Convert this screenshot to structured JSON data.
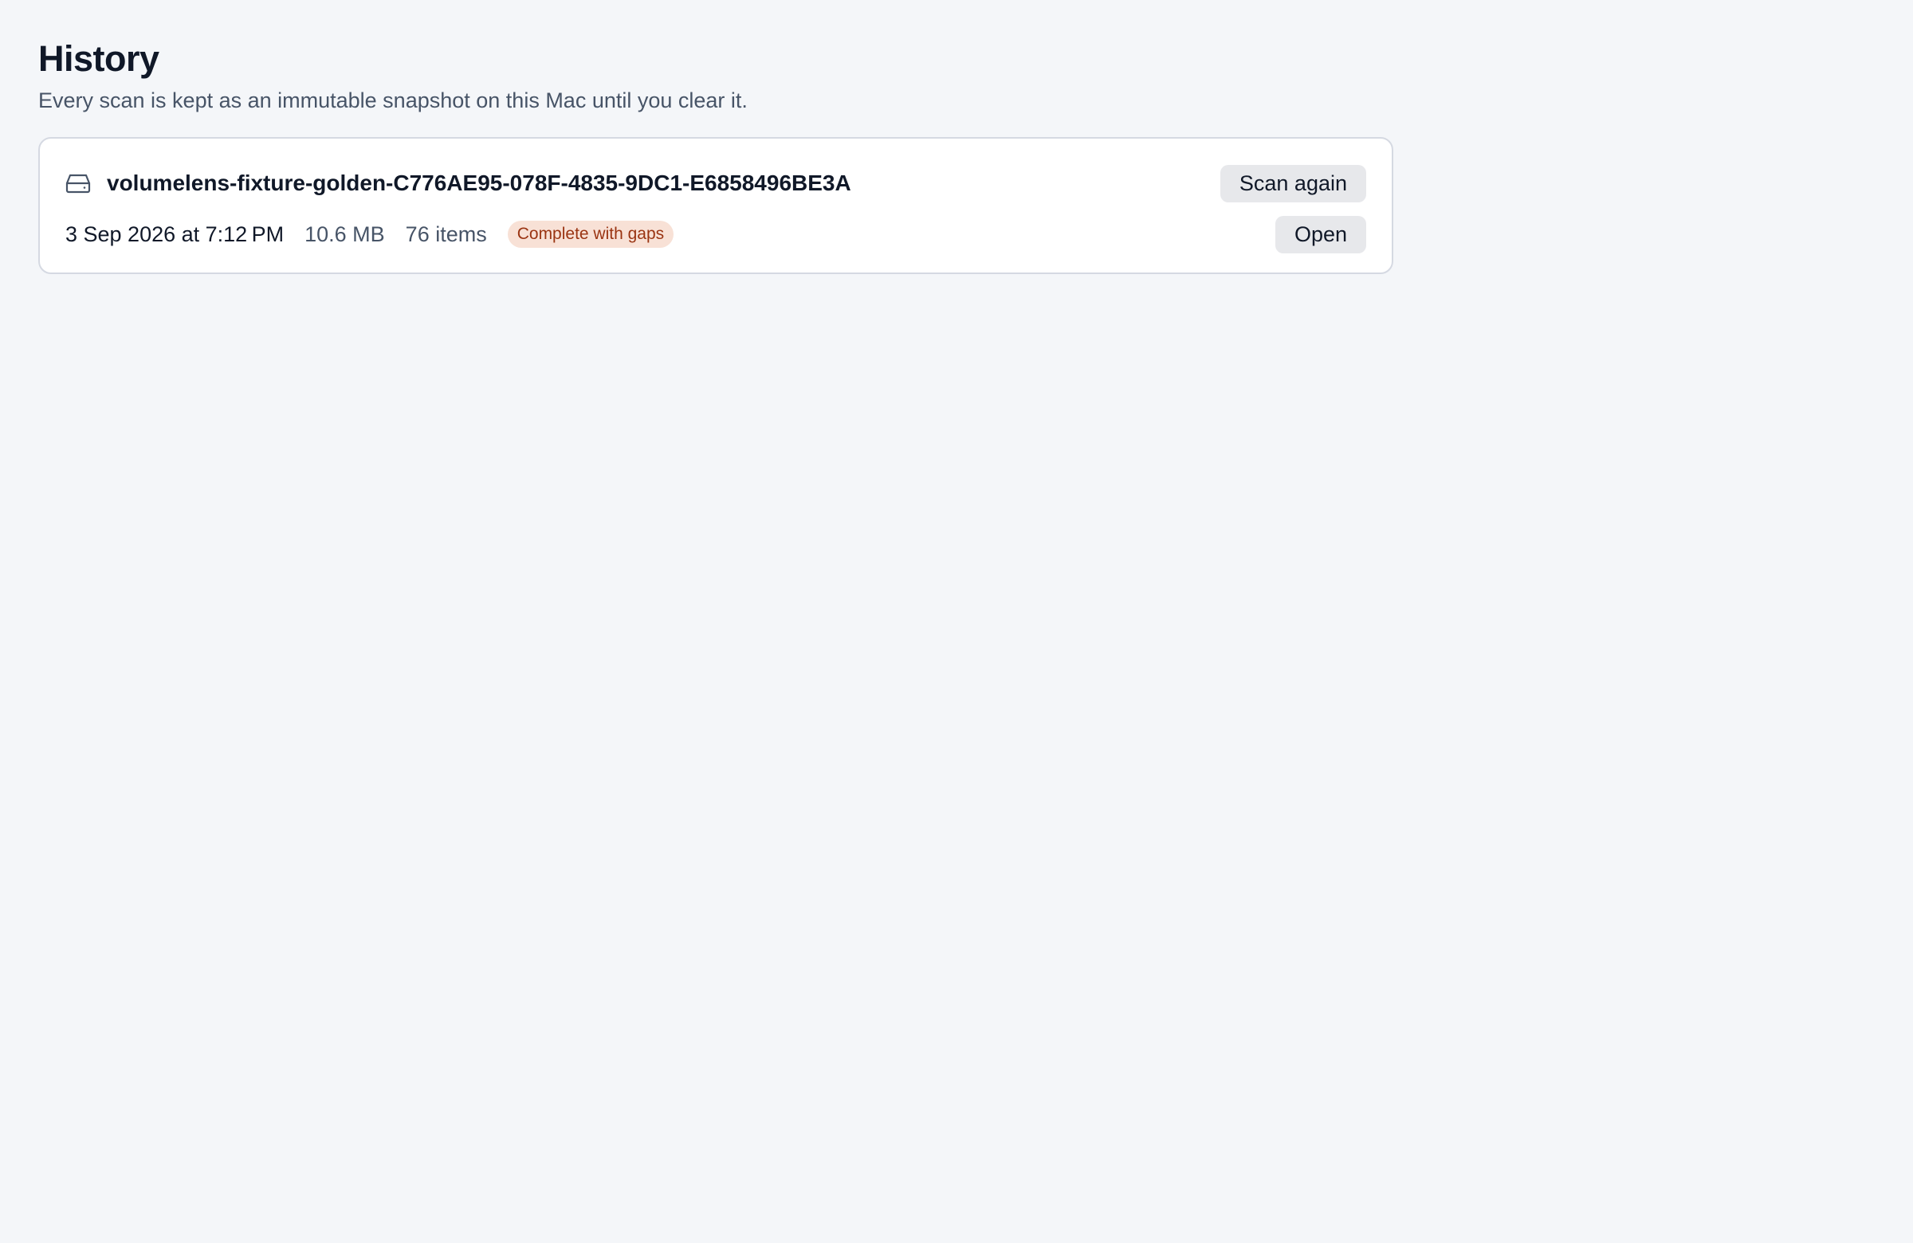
{
  "header": {
    "title": "History",
    "subtitle": "Every scan is kept as an immutable snapshot on this Mac until you clear it."
  },
  "scans": [
    {
      "volume_name": "volumelens-fixture-golden-C776AE95-078F-4835-9DC1-E6858496BE3A",
      "icon": "drive-icon",
      "date": "3 Sep 2026 at 7:12 PM",
      "size": "10.6 MB",
      "items": "76 items",
      "status": "Complete with gaps",
      "scan_again_label": "Scan again",
      "open_label": "Open"
    }
  ],
  "colors": {
    "background": "#f4f6f9",
    "card": "#ffffff",
    "status_text": "#9a3412",
    "status_bg": "#f8e1d6",
    "button_bg": "#e7e8eb"
  }
}
